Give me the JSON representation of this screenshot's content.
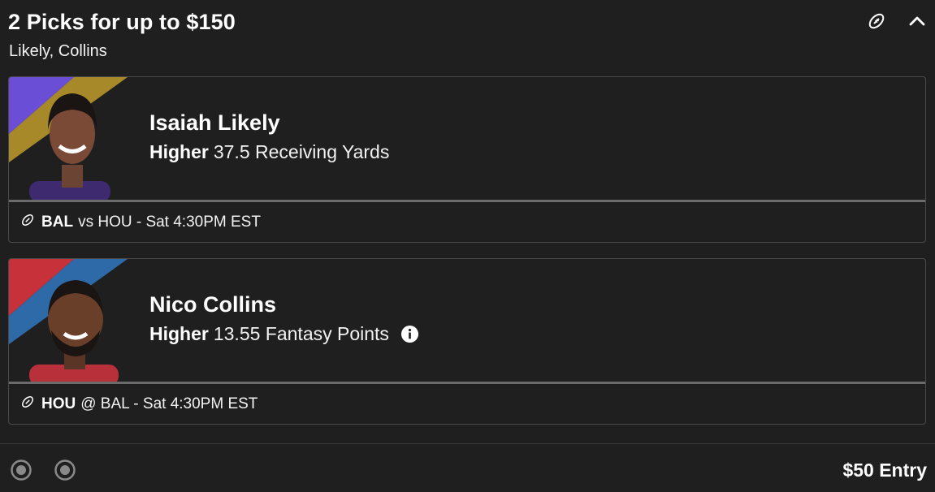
{
  "header": {
    "title": "2 Picks for up to $150",
    "subtitle": "Likely, Collins",
    "icons": [
      "football-icon",
      "chevron-up-icon"
    ]
  },
  "picks": [
    {
      "player": "Isaiah Likely",
      "direction": "Higher",
      "line": "37.5 Receiving Yards",
      "team": "BAL",
      "matchup": "vs HOU - Sat 4:30PM EST",
      "colors": [
        "#6a4fd6",
        "#a8892a"
      ],
      "has_info": false
    },
    {
      "player": "Nico Collins",
      "direction": "Higher",
      "line": "13.55 Fantasy Points",
      "team": "HOU",
      "matchup": "@ BAL - Sat 4:30PM EST",
      "colors": [
        "#c7323a",
        "#2e6aa8"
      ],
      "has_info": true
    }
  ],
  "footer": {
    "entry": "$50 Entry"
  }
}
